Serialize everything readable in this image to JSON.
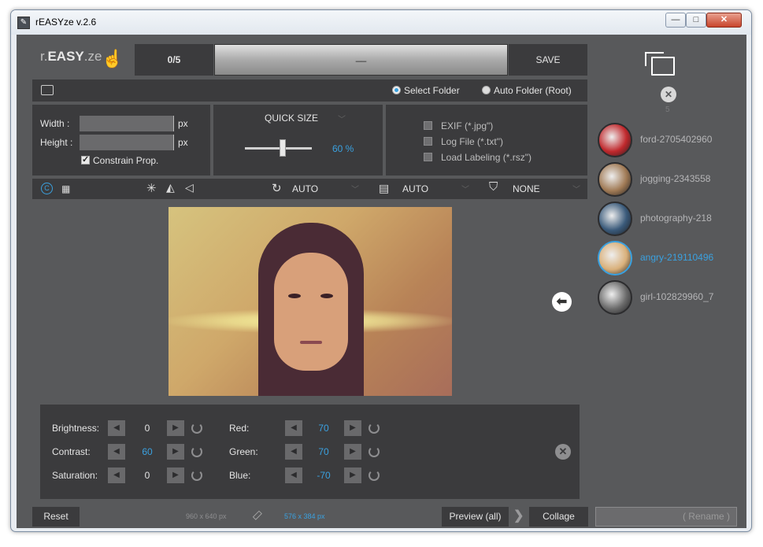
{
  "window": {
    "title": "rEASYze v.2.6",
    "minimize": "—",
    "maximize": "□",
    "close": "✕"
  },
  "header": {
    "logo_prefix": "r.",
    "logo_main": "EASY",
    "logo_suffix": ".ze",
    "counter": "0/5",
    "progress_text": "__",
    "save_label": "SAVE"
  },
  "folder": {
    "select_folder": "Select Folder",
    "auto_folder": "Auto Folder (Root)",
    "selected": "Select Folder"
  },
  "size": {
    "width_label": "Width :",
    "height_label": "Height :",
    "unit": "px",
    "width_value": "",
    "height_value": "",
    "constrain": "Constrain Prop."
  },
  "quicksize": {
    "label": "QUICK SIZE",
    "percent": "60 %",
    "value": 60
  },
  "options": {
    "exif": "EXIF (*.jpg\")",
    "log": "Log File (*.txt\")",
    "labeling": "Load Labeling (*.rsz\")"
  },
  "toolbar": {
    "rotate": "AUTO",
    "format": "AUTO",
    "filter": "NONE"
  },
  "adjust": {
    "brightness_label": "Brightness:",
    "brightness": "0",
    "contrast_label": "Contrast:",
    "contrast": "60",
    "saturation_label": "Saturation:",
    "saturation": "0",
    "red_label": "Red:",
    "red": "70",
    "green_label": "Green:",
    "green": "70",
    "blue_label": "Blue:",
    "blue": "-70"
  },
  "footer": {
    "reset": "Reset",
    "original_size": "960 x 640 px",
    "new_size": "576 x 384 px",
    "preview_all": "Preview (all)",
    "collage": "Collage",
    "rename": "( Rename )"
  },
  "files": {
    "count": "5",
    "items": [
      {
        "name": "ford-2705402960",
        "color": "#c0282c"
      },
      {
        "name": "jogging-2343558",
        "color": "#a07a55"
      },
      {
        "name": "photography-218",
        "color": "#3a5a7a"
      },
      {
        "name": "angry-219110496",
        "color": "#d9b07a"
      },
      {
        "name": "girl-102829960_7",
        "color": "#6a6a6a"
      }
    ],
    "selected": 3
  },
  "colors": {
    "accent": "#3aa1e0",
    "panel": "#3b3b3d",
    "background": "#58595b"
  }
}
